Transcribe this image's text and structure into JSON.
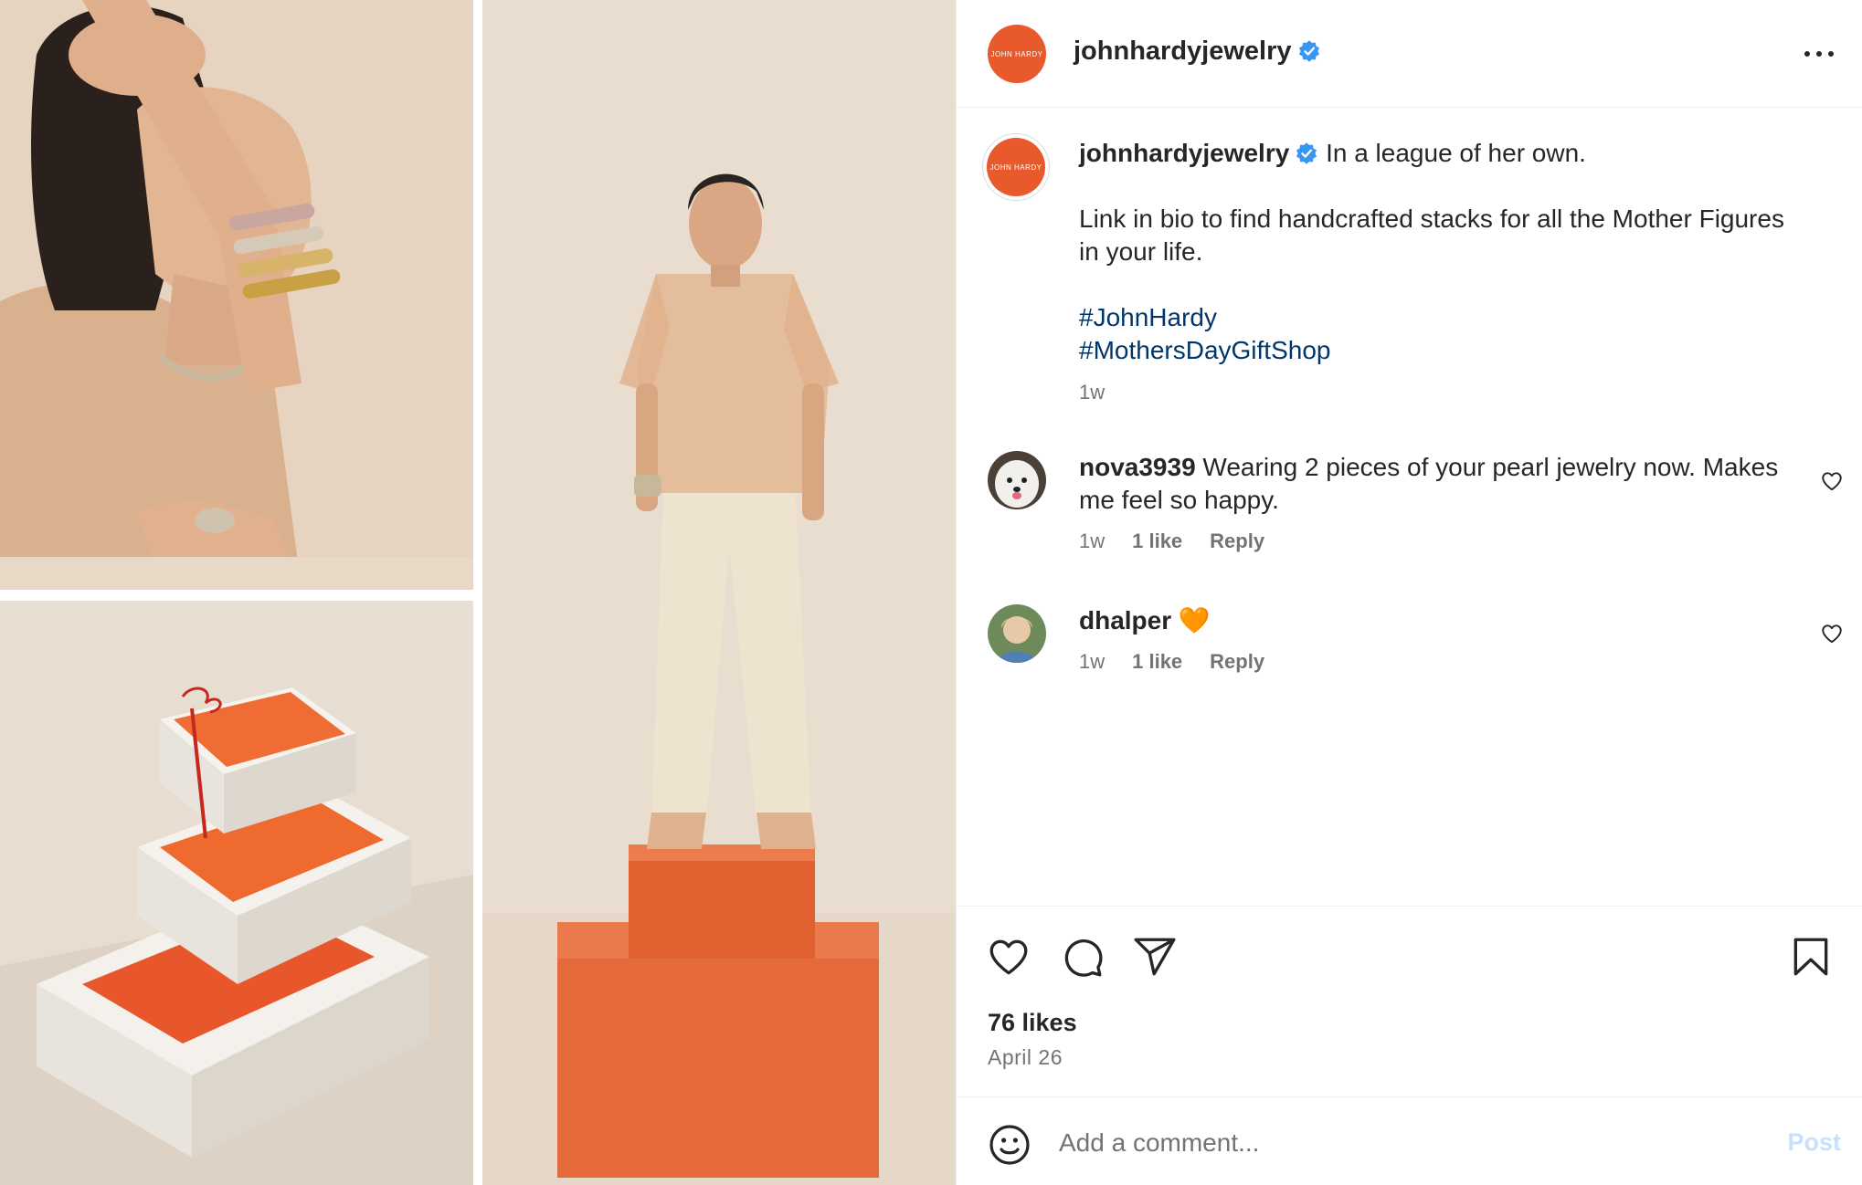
{
  "post": {
    "username": "johnhardyjewelry",
    "logo_text": "JOHN HARDY",
    "verified_icon": "verified-badge-icon",
    "more_icon": "more-options-icon"
  },
  "caption": {
    "username": "johnhardyjewelry",
    "line1": "In a league of her own.",
    "line2": "Link in bio to find handcrafted stacks for all the Mother Figures in your life.",
    "hashtags": [
      "#JohnHardy",
      "#MothersDayGiftShop"
    ],
    "timestamp": "1w"
  },
  "comments": [
    {
      "username": "nova3939",
      "text": "Wearing 2 pieces of your pearl jewelry now. Makes me feel so happy.",
      "time": "1w",
      "likes": "1 like",
      "reply": "Reply"
    },
    {
      "username": "dhalper",
      "text": "🧡",
      "time": "1w",
      "likes": "1 like",
      "reply": "Reply"
    }
  ],
  "actions": {
    "like_icon": "heart-icon",
    "comment_icon": "comment-icon",
    "share_icon": "share-icon",
    "save_icon": "bookmark-icon",
    "likes_count": "76 likes",
    "date": "April 26"
  },
  "add_comment": {
    "placeholder": "Add a comment...",
    "post_label": "Post",
    "emoji_icon": "emoji-icon"
  },
  "colors": {
    "brand_orange": "#e85a2c",
    "hashtag_blue": "#00376b",
    "muted_text": "#737373",
    "post_disabled": "#c7e0fd",
    "verified_blue": "#3897f0"
  }
}
